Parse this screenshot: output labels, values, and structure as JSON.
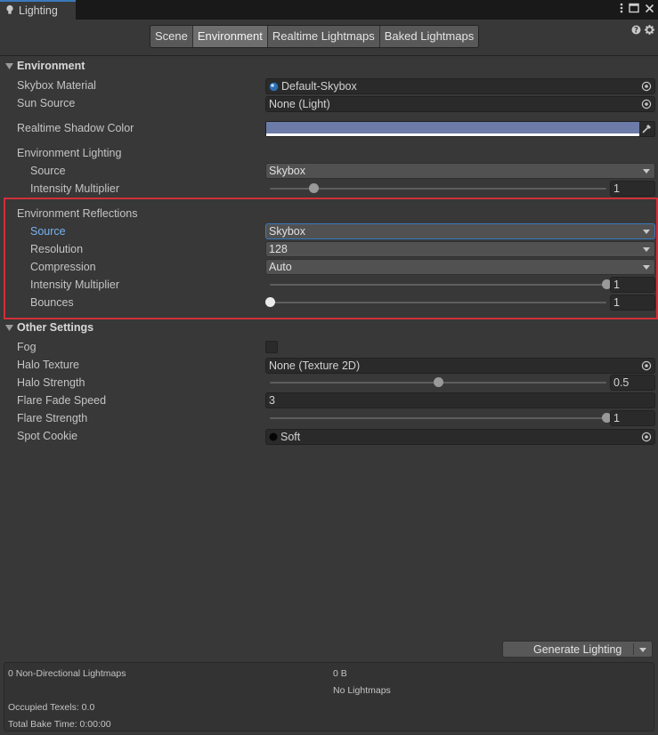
{
  "window": {
    "tab_title": "Lighting",
    "icons": [
      "more-icon",
      "maximize-icon",
      "close-icon"
    ]
  },
  "tabs": [
    {
      "label": "Scene",
      "active": false
    },
    {
      "label": "Environment",
      "active": true
    },
    {
      "label": "Realtime Lightmaps",
      "active": false
    },
    {
      "label": "Baked Lightmaps",
      "active": false
    }
  ],
  "corner_icons": [
    "help-icon",
    "settings-icon"
  ],
  "environment": {
    "header": "Environment",
    "skybox_material": {
      "label": "Skybox Material",
      "value": "Default-Skybox"
    },
    "sun_source": {
      "label": "Sun Source",
      "value": "None (Light)"
    },
    "shadow_color": {
      "label": "Realtime Shadow Color",
      "color": "#6c7ba8"
    },
    "lighting": {
      "group_label": "Environment Lighting",
      "source_label": "Source",
      "source_value": "Skybox",
      "intensity_label": "Intensity Multiplier",
      "intensity_value": "1",
      "intensity_fraction": 0.13
    },
    "reflections": {
      "group_label": "Environment Reflections",
      "source_label": "Source",
      "source_value": "Skybox",
      "resolution_label": "Resolution",
      "resolution_value": "128",
      "compression_label": "Compression",
      "compression_value": "Auto",
      "intensity_label": "Intensity Multiplier",
      "intensity_value": "1",
      "intensity_fraction": 1.0,
      "bounces_label": "Bounces",
      "bounces_value": "1",
      "bounces_fraction": 0.0
    }
  },
  "other": {
    "header": "Other Settings",
    "fog": {
      "label": "Fog",
      "checked": false
    },
    "halo_texture": {
      "label": "Halo Texture",
      "value": "None (Texture 2D)"
    },
    "halo_strength": {
      "label": "Halo Strength",
      "value": "0.5",
      "fraction": 0.5
    },
    "flare_fade": {
      "label": "Flare Fade Speed",
      "value": "3"
    },
    "flare_strength": {
      "label": "Flare Strength",
      "value": "1",
      "fraction": 1.0
    },
    "spot_cookie": {
      "label": "Spot Cookie",
      "value": "Soft"
    }
  },
  "footer": {
    "generate_label": "Generate Lighting",
    "non_directional": "0 Non-Directional Lightmaps",
    "size": "0 B",
    "no_lightmaps": "No Lightmaps",
    "occupied": "Occupied Texels: 0.0",
    "bake_time": "Total Bake Time: 0:00:00"
  },
  "colors": {
    "accent": "#3a79bb",
    "highlight_box": "#d0303a",
    "highlight_label": "#7ab2f0"
  }
}
